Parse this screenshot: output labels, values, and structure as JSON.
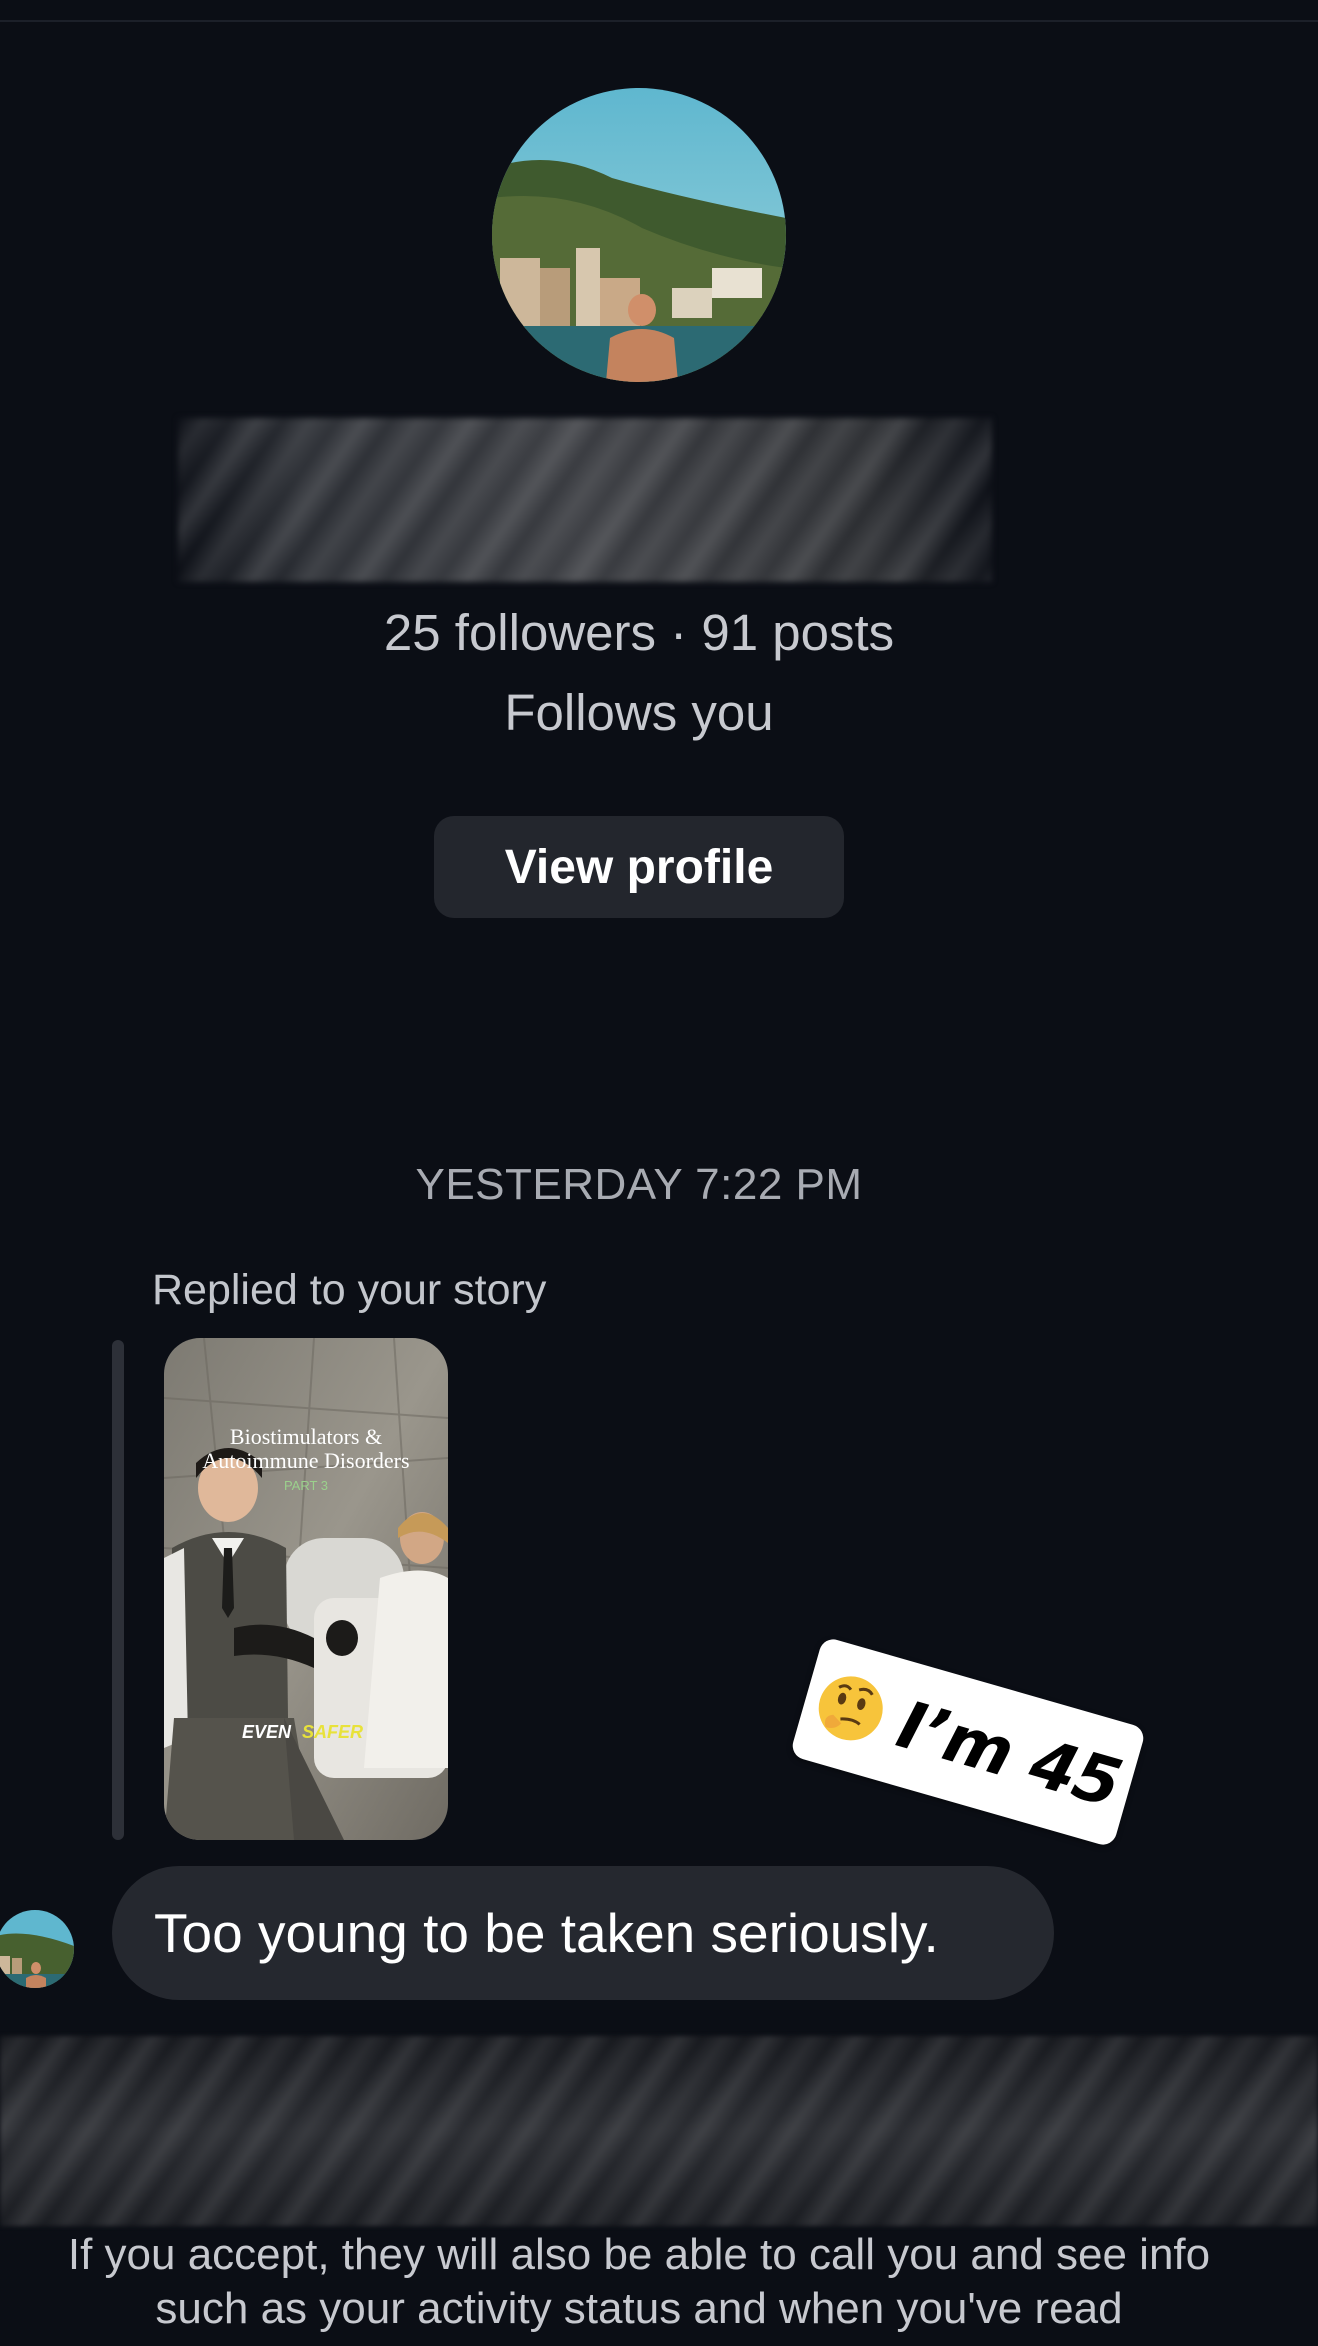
{
  "profile": {
    "followers_posts": "25 followers · 91 posts",
    "follows_status": "Follows you",
    "view_profile_label": "View profile"
  },
  "conversation": {
    "timestamp": "YESTERDAY 7:22 PM",
    "replied_label": "Replied to your story",
    "story": {
      "title_line1": "Biostimulators &",
      "title_line2": "Autoimmune Disorders",
      "part_label": "PART 3",
      "caption_word1": "EVEN",
      "caption_word2": "SAFER"
    },
    "message_text": "Too young to be taken seriously.",
    "sticker_text": "I’m 45",
    "sticker_emoji": "thinking-face-icon"
  },
  "footer": {
    "line1": "If you accept, they will also be able to call you and see info",
    "line2": "such as your activity status and when you've read"
  },
  "colors": {
    "background": "#0b0e15",
    "bubble": "#25282f",
    "button": "#23262d",
    "secondary_text": "#c7c9cf",
    "caption_highlight": "#e8e23a"
  }
}
